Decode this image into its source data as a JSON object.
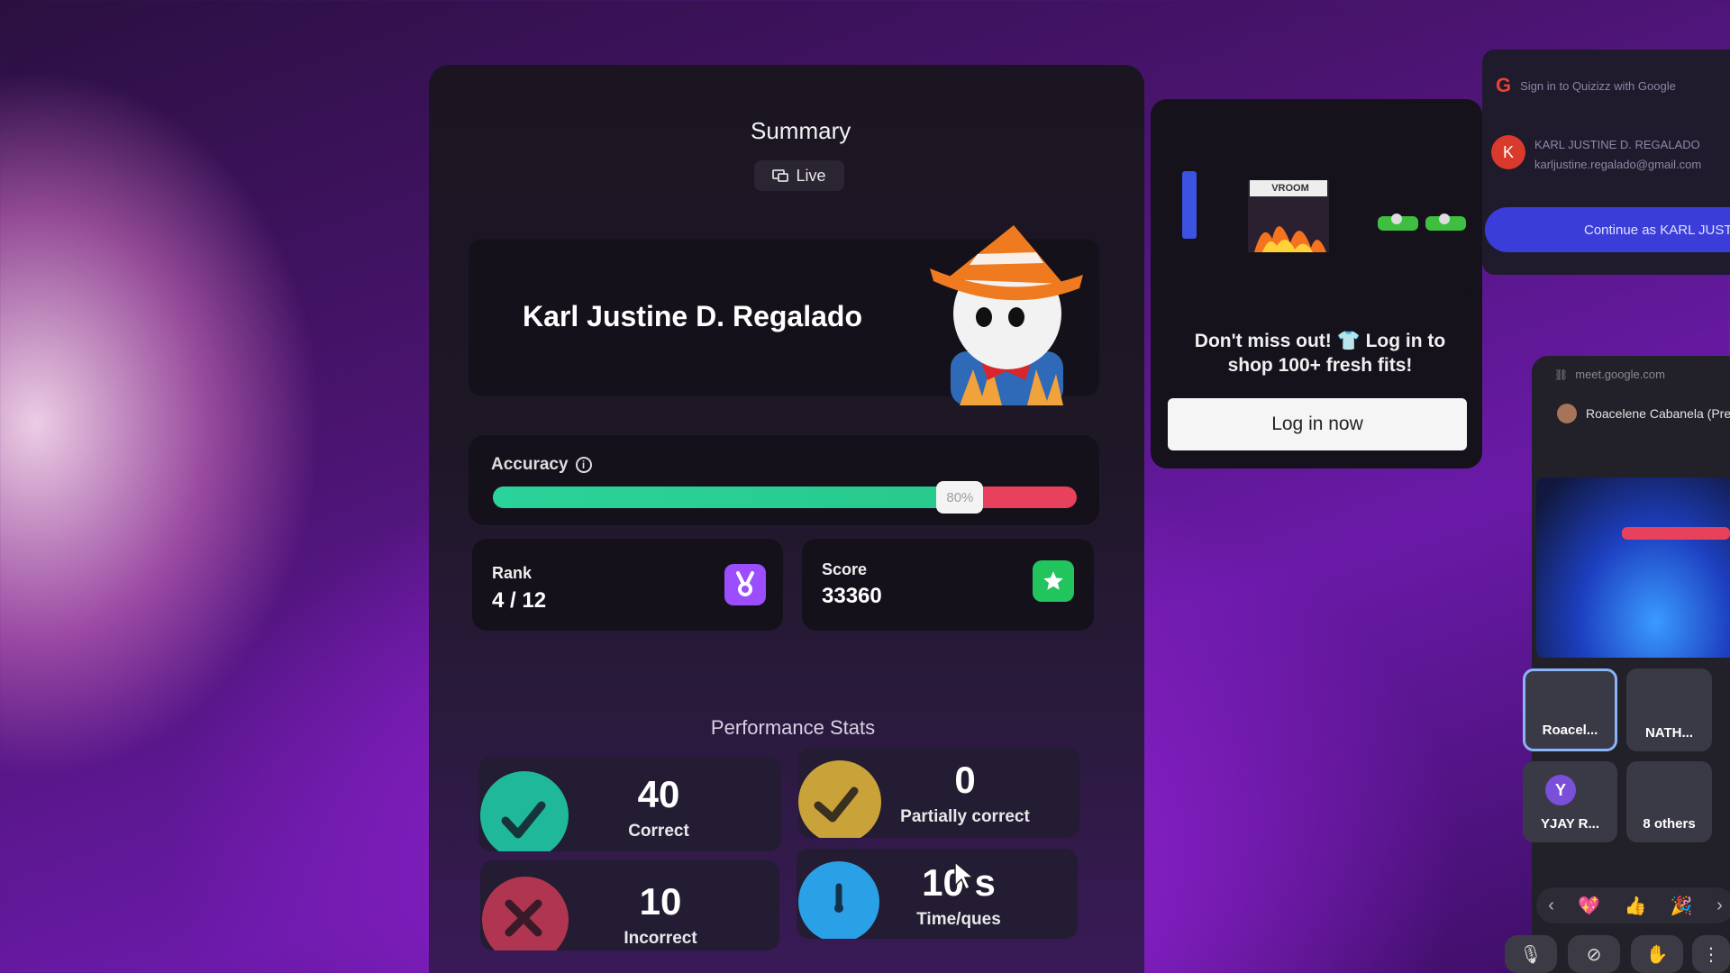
{
  "summary": {
    "title": "Summary",
    "live_label": "Live",
    "player_name": "Karl Justine D. Regalado",
    "accuracy": {
      "label": "Accuracy",
      "percent": 80,
      "percent_label": "80%"
    },
    "rank": {
      "label": "Rank",
      "value": "4 / 12"
    },
    "score": {
      "label": "Score",
      "value": "33360"
    },
    "performance_title": "Performance Stats",
    "stats": {
      "correct": {
        "value": "40",
        "label": "Correct"
      },
      "partial": {
        "value": "0",
        "label": "Partially correct"
      },
      "incorrect": {
        "value": "10",
        "label": "Incorrect"
      },
      "time": {
        "value": "10 s",
        "label": "Time/ques"
      }
    }
  },
  "promo": {
    "line1": "Don't miss out! 👕 Log in to",
    "line2": "shop 100+ fresh fits!",
    "banner_text": "VROOM",
    "button_label": "Log in now"
  },
  "google_signin": {
    "header": "Sign in to Quizizz with Google",
    "avatar_letter": "K",
    "account_name": "KARL JUSTINE D. REGALADO",
    "account_email": "karljustine.regalado@gmail.com",
    "continue_label": "Continue as KARL JUSTINE"
  },
  "meet": {
    "url": "meet.google.com",
    "presenter": "Roacelene Cabanela (Presenting)",
    "tiles": [
      "Roacel...",
      "NATH...",
      "YJAY R...",
      "8 others"
    ],
    "tile_letter": "Y",
    "reactions": [
      "‹",
      "💖",
      "👍",
      "🎉",
      "›"
    ]
  },
  "colors": {
    "accent_green": "#2ad39a",
    "accent_red": "#e8415c",
    "rank_badge": "#9b4dff",
    "score_badge": "#22c45e",
    "correct": "#1fb89a",
    "partial": "#c9a23a",
    "incorrect": "#b03550",
    "time": "#2aa0e6"
  }
}
